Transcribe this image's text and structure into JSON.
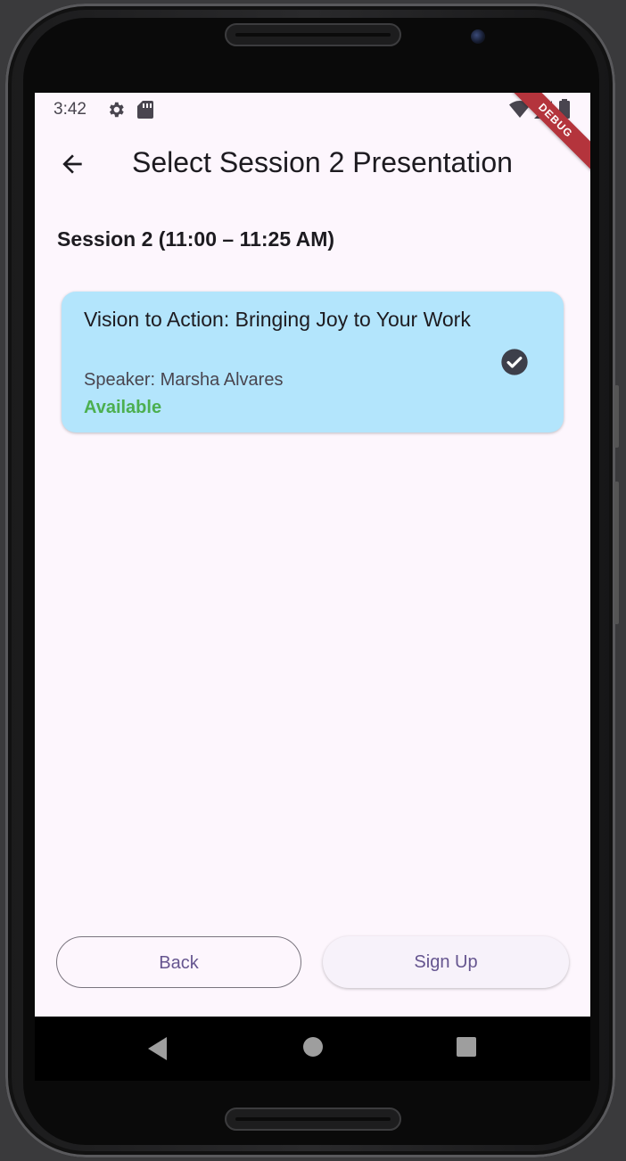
{
  "status_bar": {
    "time": "3:42",
    "icons": [
      "gear-icon",
      "sd-card-icon",
      "wifi-icon",
      "signal-icon",
      "battery-icon"
    ],
    "debug_banner": "DEBUG"
  },
  "app_bar": {
    "back_icon": "arrow-left-icon",
    "title": "Select Session 2 Presentation"
  },
  "session": {
    "header": "Session 2 (11:00 – 11:25 AM)"
  },
  "presentations": [
    {
      "title": "Vision to Action: Bringing Joy to Your Work",
      "speaker": "Speaker: Marsha Alvares",
      "status": "Available",
      "selected": true,
      "status_color": "#4caf50",
      "card_color": "#b3e5fc"
    }
  ],
  "buttons": {
    "back_label": "Back",
    "signup_label": "Sign Up"
  },
  "theme": {
    "background": "#fdf6fd",
    "accent": "#65558f",
    "debug_color": "#b4343c"
  },
  "nav_bar": {
    "icons": [
      "back-triangle-icon",
      "home-circle-icon",
      "recents-square-icon"
    ]
  }
}
